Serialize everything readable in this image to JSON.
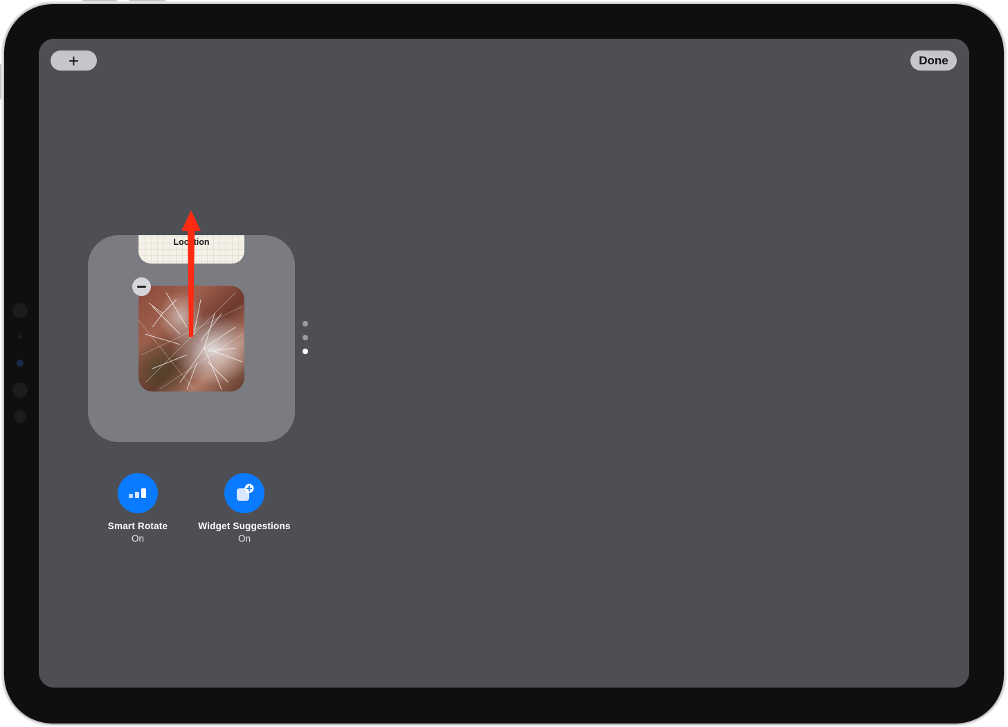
{
  "toolbar": {
    "add_label": "+",
    "done_label": "Done"
  },
  "widget_stack": {
    "peek_widget_label": "Location",
    "photo_widget": "photo",
    "remove_icon": "minus-circle-icon",
    "pages": 3,
    "active_page": 3
  },
  "toggles": [
    {
      "name": "Smart Rotate",
      "state": "On",
      "icon": "smart-rotate-icon"
    },
    {
      "name": "Widget Suggestions",
      "state": "On",
      "icon": "widget-suggestions-icon"
    }
  ],
  "annotation": {
    "icon": "red-up-arrow",
    "color": "#ff2a12"
  },
  "colors": {
    "screen": "#4e4f54",
    "stack": "#7b7c82",
    "accent": "#0a7aff"
  }
}
